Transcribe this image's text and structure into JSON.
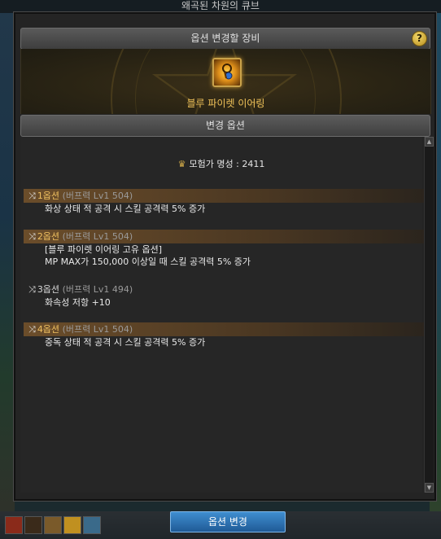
{
  "window": {
    "title": "왜곡된 차원의 큐브",
    "header": "옵션 변경할 장비",
    "help_label": "?",
    "section": "변경 옵션"
  },
  "item": {
    "name": "블루 파이렛 이어링",
    "icon": "earring-icon"
  },
  "fame": {
    "label": "모험가 명성 : 2411",
    "icon": "fame-crown-icon"
  },
  "options": [
    {
      "index": "1옵션",
      "meta": "(버프력 Lv1  504)",
      "lines": [
        "화상 상태 적 공격 시 스킬 공격력 5% 증가"
      ],
      "highlight": true
    },
    {
      "index": "2옵션",
      "meta": "(버프력 Lv1  504)",
      "lines": [
        "[블루 파이렛 이어링 고유 옵션]",
        "MP MAX가 150,000 이상일 때 스킬 공격력 5% 증가"
      ],
      "highlight": true
    },
    {
      "index": "3옵션",
      "meta": "(버프력 Lv1  494)",
      "lines": [
        "화속성 저항 +10"
      ],
      "highlight": false
    },
    {
      "index": "4옵션",
      "meta": "(버프력 Lv1  504)",
      "lines": [
        "중독 상태 적 공격 시 스킬 공격력 5% 증가"
      ],
      "highlight": true
    }
  ],
  "footer": {
    "change_button": "옵션 변경"
  },
  "colors": {
    "accent_gold": "#f2c45a",
    "button_blue": "#2f78b8"
  }
}
